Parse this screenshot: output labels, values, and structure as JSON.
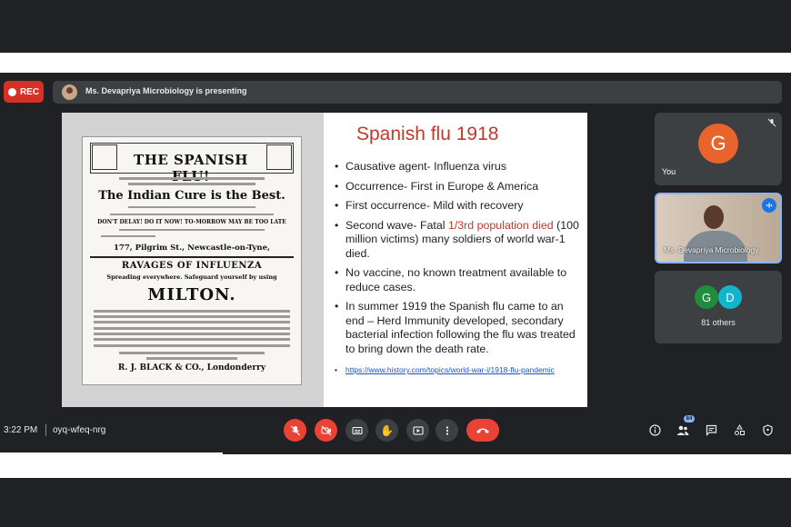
{
  "recording": {
    "label": "REC"
  },
  "presenter_banner": {
    "text": "Ms. Devapriya Microbiology is presenting"
  },
  "slide": {
    "title": "Spanish flu 1918",
    "bullets": [
      {
        "text": "Causative agent- Influenza virus"
      },
      {
        "text": "Occurrence- First in Europe & America"
      },
      {
        "text": "First occurrence- Mild with recovery"
      },
      {
        "pre": "Second wave- Fatal ",
        "red": "1/3rd population died",
        "post": " (100 million victims) many soldiers of world war-1 died."
      },
      {
        "text": "No vaccine, no known treatment available to reduce cases."
      },
      {
        "text": "In summer 1919 the Spanish flu came to an end – Herd Immunity developed, secondary bacterial infection following the flu was treated to bring down the death rate."
      }
    ],
    "link": "https://www.history.com/topics/world-war-i/1918-flu-pandemic",
    "clipping": {
      "title": "THE SPANISH FLU!",
      "cure": "The Indian Cure is the Best.",
      "line1": "DON'T DELAY!   DO IT NOW!   TO-MORROW MAY BE TOO LATE",
      "address": "177, Pilgrim St., Newcastle-on-Tyne,",
      "ravages": "RAVAGES OF INFLUENZA",
      "spreading": "Spreading everywhere.     Safeguard yourself by using",
      "milton": "MILTON.",
      "distributor": "R. J. BLACK & CO., Londonderry"
    }
  },
  "participants": {
    "self": {
      "initial": "G",
      "label": "You"
    },
    "presenter": {
      "label": "Ms. Devapriya Microbiology"
    },
    "others": {
      "initials": [
        "G",
        "D"
      ],
      "label": "81 others"
    }
  },
  "footer": {
    "time": "3:22 PM",
    "meeting_code": "oyq-wfeq-nrg",
    "participant_count": "84"
  },
  "colors": {
    "accent_red": "#ea4335",
    "slide_title": "#c0392b",
    "avatar_g": "#e8642c"
  }
}
